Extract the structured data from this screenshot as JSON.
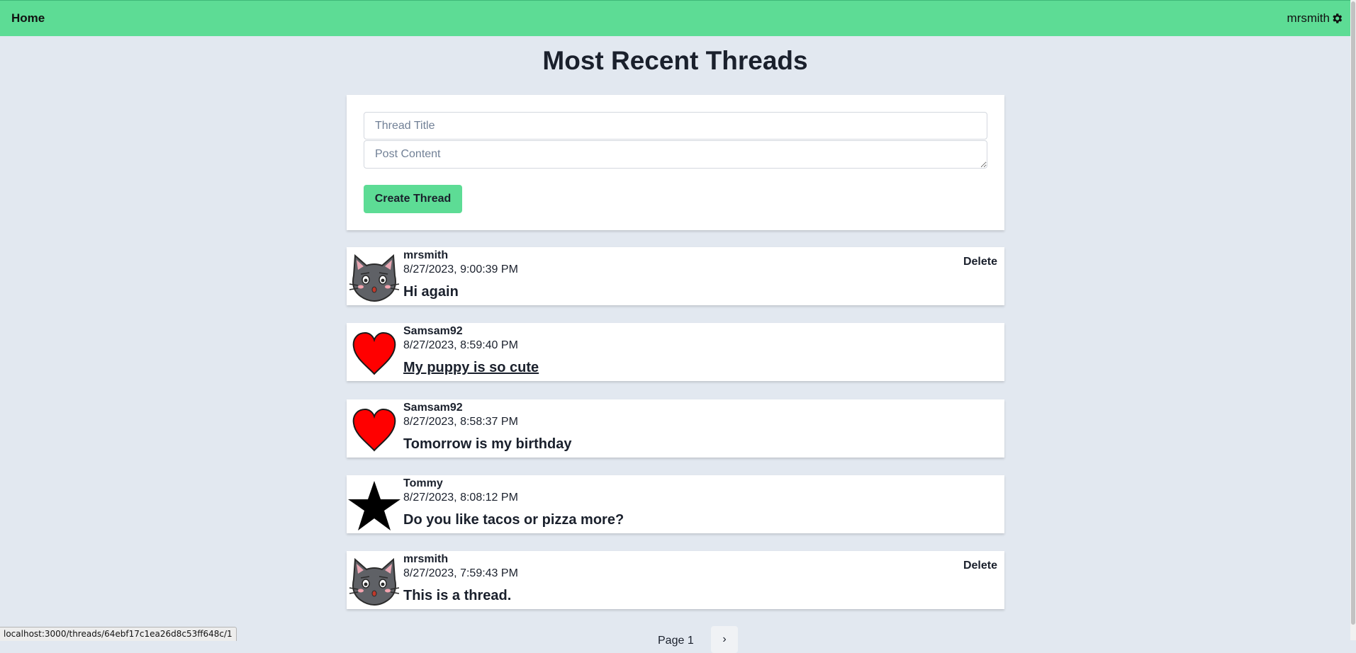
{
  "nav": {
    "home_label": "Home",
    "username": "mrsmith",
    "settings_icon": "gear-icon"
  },
  "page": {
    "title": "Most Recent Threads"
  },
  "form": {
    "title_placeholder": "Thread Title",
    "content_placeholder": "Post Content",
    "create_label": "Create Thread"
  },
  "threads": [
    {
      "author": "mrsmith",
      "time": "8/27/2023, 9:00:39 PM",
      "title": "Hi again",
      "avatar": "cat-avatar-icon",
      "delete_label": "Delete"
    },
    {
      "author": "Samsam92",
      "time": "8/27/2023, 8:59:40 PM",
      "title": "My puppy is so cute",
      "avatar": "heart-avatar-icon"
    },
    {
      "author": "Samsam92",
      "time": "8/27/2023, 8:58:37 PM",
      "title": "Tomorrow is my birthday",
      "avatar": "heart-avatar-icon"
    },
    {
      "author": "Tommy",
      "time": "8/27/2023, 8:08:12 PM",
      "title": "Do you like tacos or pizza more?",
      "avatar": "star-avatar-icon"
    },
    {
      "author": "mrsmith",
      "time": "8/27/2023, 7:59:43 PM",
      "title": "This is a thread.",
      "avatar": "cat-avatar-icon",
      "delete_label": "Delete"
    }
  ],
  "pagination": {
    "page_label": "Page 1",
    "next_icon": "chevron-right-icon"
  },
  "status_bar": {
    "url": "localhost:3000/threads/64ebf17c1ea26d8c53ff648c/1"
  }
}
